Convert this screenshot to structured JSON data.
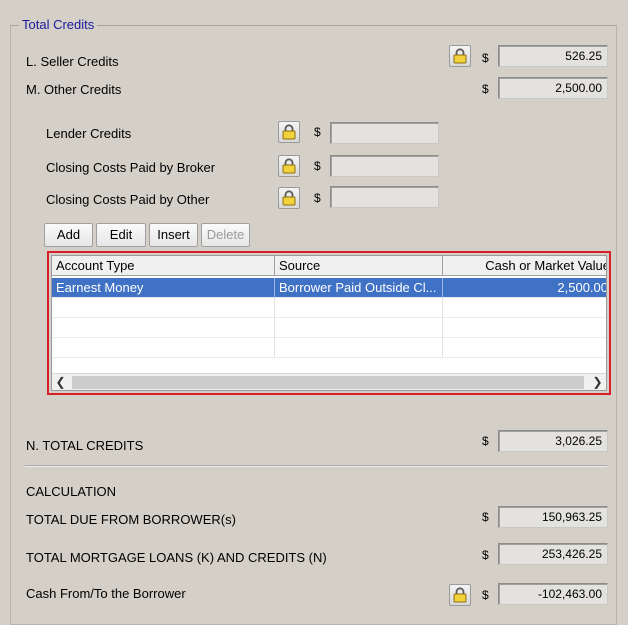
{
  "group_title": "Total Credits",
  "currency_symbol": "$",
  "seller_credits": {
    "label": "L. Seller Credits",
    "value": "526.25"
  },
  "other_credits": {
    "label": "M. Other Credits",
    "value": "2,500.00"
  },
  "lender_credits": {
    "label": "Lender Credits",
    "value": ""
  },
  "broker_costs": {
    "label": "Closing Costs Paid by Broker",
    "value": ""
  },
  "other_costs": {
    "label": "Closing Costs Paid by Other",
    "value": ""
  },
  "buttons": {
    "add": "Add",
    "edit": "Edit",
    "insert": "Insert",
    "delete": "Delete"
  },
  "grid": {
    "columns": [
      "Account Type",
      "Source",
      "Cash or Market Value"
    ],
    "rows": [
      {
        "account_type": "Earnest Money",
        "source": "Borrower Paid Outside Cl...",
        "value": "2,500.00"
      }
    ]
  },
  "total_credits": {
    "label": "N. TOTAL CREDITS",
    "value": "3,026.25"
  },
  "calculation_heading": "CALCULATION",
  "total_due": {
    "label": "TOTAL DUE FROM BORROWER(s)",
    "value": "150,963.25"
  },
  "total_loans": {
    "label": "TOTAL MORTGAGE LOANS (K) AND CREDITS (N)",
    "value": "253,426.25"
  },
  "cash_from_to": {
    "label": "Cash From/To the Borrower",
    "value": "-102,463.00"
  }
}
